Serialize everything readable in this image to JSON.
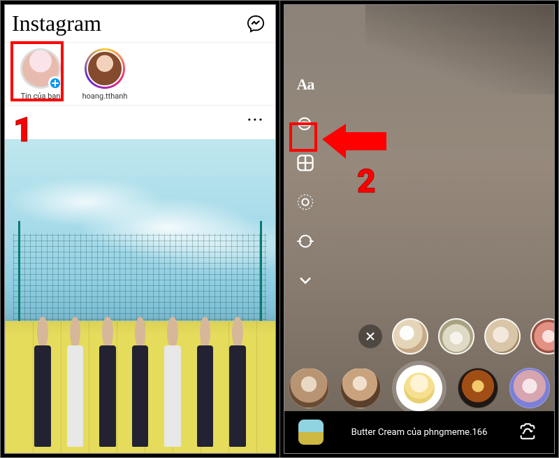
{
  "annotations": {
    "step1_number": "1",
    "step2_number": "2"
  },
  "left": {
    "header": {
      "logo_text": "Instagram"
    },
    "stories": [
      {
        "label": "Tin của bạn",
        "own": true
      },
      {
        "label": "hoang.tthanh",
        "own": false
      }
    ],
    "post": {
      "more_dots": "···"
    }
  },
  "right": {
    "tools": {
      "text_label": "Aa"
    },
    "top_row_thumbs": [
      {
        "name": "effect-thumb-1"
      },
      {
        "name": "effect-thumb-2"
      },
      {
        "name": "effect-thumb-3"
      },
      {
        "name": "effect-thumb-4"
      }
    ],
    "main_row_thumbs_left": [
      {
        "name": "effect-thumb-a"
      },
      {
        "name": "effect-thumb-b"
      }
    ],
    "main_row_thumbs_right": [
      {
        "name": "effect-thumb-c"
      },
      {
        "name": "effect-thumb-d"
      }
    ],
    "bottom": {
      "effect_label": "Butter Cream của phngmeme.166"
    }
  }
}
